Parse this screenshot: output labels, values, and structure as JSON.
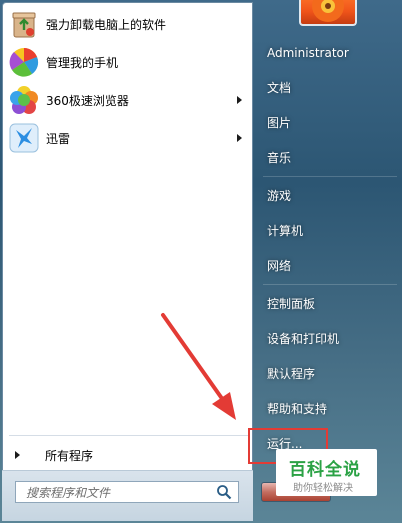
{
  "programs": [
    {
      "label": "强力卸载电脑上的软件",
      "icon": "recycle-bin-icon",
      "has_submenu": false
    },
    {
      "label": "管理我的手机",
      "icon": "phone-manager-icon",
      "has_submenu": false
    },
    {
      "label": "360极速浏览器",
      "icon": "browser-360-icon",
      "has_submenu": true
    },
    {
      "label": "迅雷",
      "icon": "thunder-bird-icon",
      "has_submenu": true
    }
  ],
  "all_programs": {
    "label": "所有程序"
  },
  "search": {
    "placeholder": "搜索程序和文件"
  },
  "right_links": {
    "user": "Administrator",
    "documents": "文档",
    "pictures": "图片",
    "music": "音乐",
    "games": "游戏",
    "computer": "计算机",
    "network": "网络",
    "control_panel": "控制面板",
    "devices_printers": "设备和打印机",
    "default_programs": "默认程序",
    "help_support": "帮助和支持",
    "run": "运行..."
  },
  "watermark": {
    "title": "百科全说",
    "subtitle": "助你轻松解决"
  },
  "colors": {
    "highlight_red": "#e33b35",
    "watermark_green": "#2ba245",
    "menu_blue": "#2c5673"
  }
}
